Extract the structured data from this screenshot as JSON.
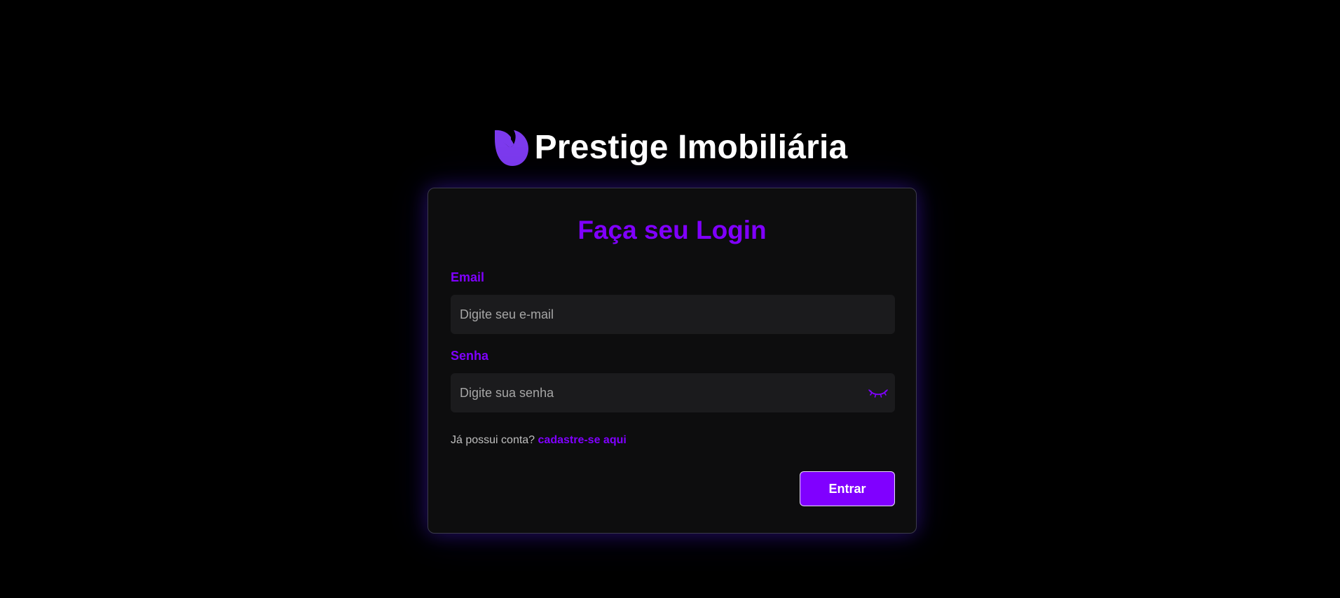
{
  "brand": {
    "title": "Prestige Imobiliária",
    "logo_icon": "leaf-logo-icon",
    "logo_color": "#7c3aed"
  },
  "login": {
    "heading": "Faça seu Login",
    "email": {
      "label": "Email",
      "value": "",
      "placeholder": "Digite seu e-mail"
    },
    "password": {
      "label": "Senha",
      "value": "",
      "placeholder": "Digite sua senha",
      "toggle_icon": "eye-closed-icon"
    },
    "signup_prompt": "Já possui conta?",
    "signup_link": "cadastre-se aqui",
    "submit_label": "Entrar"
  },
  "colors": {
    "accent": "#8000ff",
    "background": "#000000",
    "card": "#0d0d0e",
    "input": "#1b1b1d"
  }
}
